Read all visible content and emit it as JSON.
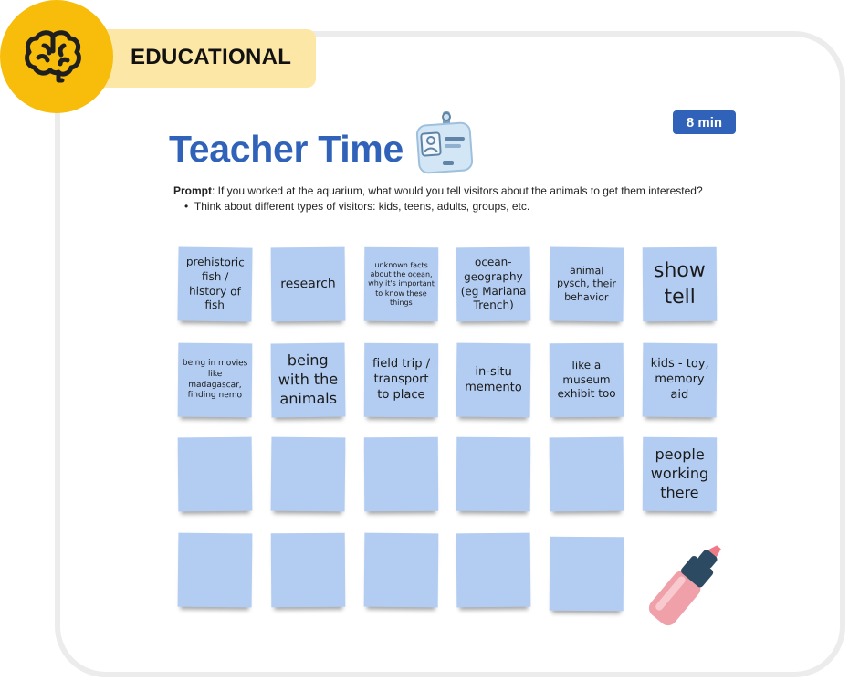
{
  "category": {
    "label": "EDUCATIONAL",
    "icon": "brain-icon"
  },
  "timer": {
    "label": "8 min"
  },
  "header": {
    "title": "Teacher Time",
    "title_icon": "id-badge-icon"
  },
  "prompt": {
    "lead": "Prompt",
    "text": ": If you worked at the aquarium, what would you tell visitors about the animals to get them interested?",
    "bullet": "Think about different types of visitors: kids, teens, adults, groups, etc."
  },
  "notes": [
    "prehistoric fish / history of fish",
    "research",
    "unknown facts about the ocean, why it's important to know these things",
    "ocean- geography (eg Mariana Trench)",
    "animal pysch, their behavior",
    "show tell",
    "being in movies like madagascar, finding nemo",
    "being with the animals",
    "field trip / transport to place",
    "in-situ memento",
    "like a museum exhibit too",
    "kids - toy, memory aid",
    "",
    "",
    "",
    "",
    "",
    "people working there",
    "",
    "",
    "",
    "",
    ""
  ],
  "tools": {
    "marker": "marker-icon"
  },
  "colors": {
    "accent": "#2f62b8",
    "badge": "#f7bd0a",
    "tag": "#fde7a6",
    "sticky": "#b3cdf2",
    "marker": "#f0a0a8"
  }
}
